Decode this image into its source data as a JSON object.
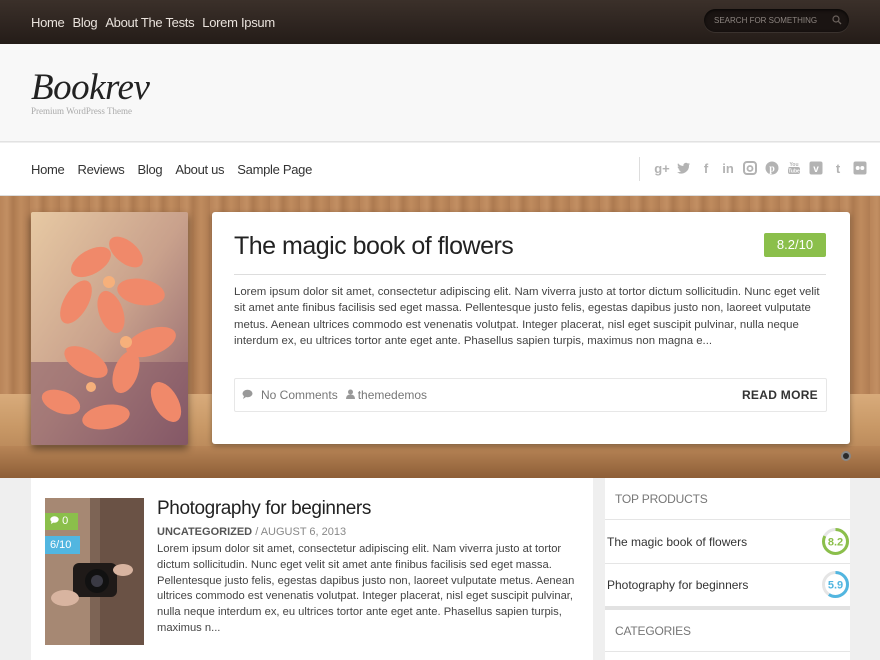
{
  "topbar": {
    "nav": [
      "Home",
      "Blog",
      "About The Tests",
      "Lorem Ipsum"
    ],
    "search_placeholder": "SEARCH FOR SOMETHING"
  },
  "header": {
    "logo": "Bookrev",
    "tagline": "Premium WordPress Theme"
  },
  "mainnav": {
    "links": [
      "Home",
      "Reviews",
      "Blog",
      "About us",
      "Sample Page"
    ],
    "social_icons": [
      "google-plus-icon",
      "twitter-icon",
      "facebook-icon",
      "linkedin-icon",
      "instagram-icon",
      "pinterest-icon",
      "youtube-icon",
      "vimeo-icon",
      "tumblr-icon",
      "flickr-icon"
    ]
  },
  "featured": {
    "title": "The magic book of flowers",
    "score": "8.2/10",
    "excerpt": "Lorem ipsum dolor sit amet, consectetur adipiscing elit. Nam viverra justo at tortor dictum sollicitudin. Nunc eget velit sit amet ante finibus facilisis sed eget massa. Pellentesque justo felis, egestas dapibus justo non, laoreet vulputate metus. Aenean ultrices commodo est venenatis volutpat. Integer placerat, nisl eget suscipit pulvinar, nulla neque interdum ex, eu ultrices tortor ante eget ante. Phasellus sapien turpis, maximus non magna e...",
    "comments": "No Comments",
    "author": "themedemos",
    "read_more": "READ MORE"
  },
  "post": {
    "title": "Photography for beginners",
    "category": "UNCATEGORIZED",
    "date": "/ AUGUST 6, 2013",
    "comments_count": "0",
    "rating": "6/10",
    "excerpt": "Lorem ipsum dolor sit amet, consectetur adipiscing elit. Nam viverra justo at tortor dictum sollicitudin. Nunc eget velit sit amet ante finibus facilisis sed eget massa. Pellentesque justo felis, egestas dapibus justo non, laoreet vulputate metus. Aenean ultrices commodo est venenatis volutpat. Integer placerat, nisl eget suscipit pulvinar, nulla neque interdum ex, eu ultrices tortor ante eget ante. Phasellus sapien turpis, maximus n..."
  },
  "sidebar": {
    "top_products_title": "TOP PRODUCTS",
    "products": [
      {
        "name": "The magic book of flowers",
        "score": "8.2",
        "color": "#8bbf4b",
        "fraction": 0.82
      },
      {
        "name": "Photography for beginners",
        "score": "5.9",
        "color": "#52b6e0",
        "fraction": 0.59
      }
    ],
    "categories_title": "CATEGORIES"
  },
  "colors": {
    "green": "#8bbf4b",
    "blue": "#52b6e0"
  }
}
